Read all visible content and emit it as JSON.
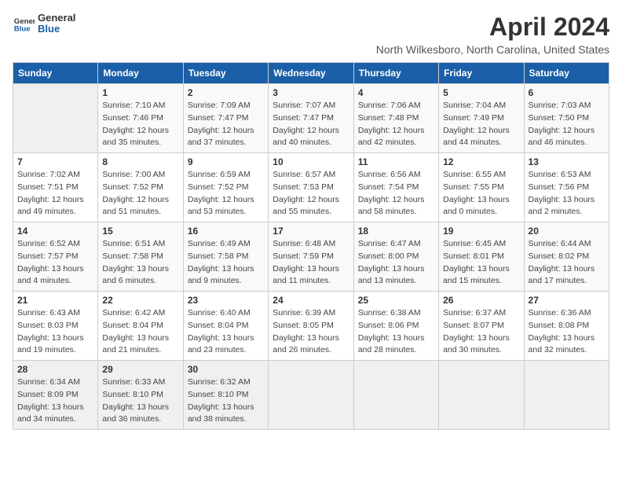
{
  "logo": {
    "general": "General",
    "blue": "Blue"
  },
  "title": "April 2024",
  "subtitle": "North Wilkesboro, North Carolina, United States",
  "weekdays": [
    "Sunday",
    "Monday",
    "Tuesday",
    "Wednesday",
    "Thursday",
    "Friday",
    "Saturday"
  ],
  "weeks": [
    [
      {
        "day": "",
        "info": ""
      },
      {
        "day": "1",
        "info": "Sunrise: 7:10 AM\nSunset: 7:46 PM\nDaylight: 12 hours\nand 35 minutes."
      },
      {
        "day": "2",
        "info": "Sunrise: 7:09 AM\nSunset: 7:47 PM\nDaylight: 12 hours\nand 37 minutes."
      },
      {
        "day": "3",
        "info": "Sunrise: 7:07 AM\nSunset: 7:47 PM\nDaylight: 12 hours\nand 40 minutes."
      },
      {
        "day": "4",
        "info": "Sunrise: 7:06 AM\nSunset: 7:48 PM\nDaylight: 12 hours\nand 42 minutes."
      },
      {
        "day": "5",
        "info": "Sunrise: 7:04 AM\nSunset: 7:49 PM\nDaylight: 12 hours\nand 44 minutes."
      },
      {
        "day": "6",
        "info": "Sunrise: 7:03 AM\nSunset: 7:50 PM\nDaylight: 12 hours\nand 46 minutes."
      }
    ],
    [
      {
        "day": "7",
        "info": "Sunrise: 7:02 AM\nSunset: 7:51 PM\nDaylight: 12 hours\nand 49 minutes."
      },
      {
        "day": "8",
        "info": "Sunrise: 7:00 AM\nSunset: 7:52 PM\nDaylight: 12 hours\nand 51 minutes."
      },
      {
        "day": "9",
        "info": "Sunrise: 6:59 AM\nSunset: 7:52 PM\nDaylight: 12 hours\nand 53 minutes."
      },
      {
        "day": "10",
        "info": "Sunrise: 6:57 AM\nSunset: 7:53 PM\nDaylight: 12 hours\nand 55 minutes."
      },
      {
        "day": "11",
        "info": "Sunrise: 6:56 AM\nSunset: 7:54 PM\nDaylight: 12 hours\nand 58 minutes."
      },
      {
        "day": "12",
        "info": "Sunrise: 6:55 AM\nSunset: 7:55 PM\nDaylight: 13 hours\nand 0 minutes."
      },
      {
        "day": "13",
        "info": "Sunrise: 6:53 AM\nSunset: 7:56 PM\nDaylight: 13 hours\nand 2 minutes."
      }
    ],
    [
      {
        "day": "14",
        "info": "Sunrise: 6:52 AM\nSunset: 7:57 PM\nDaylight: 13 hours\nand 4 minutes."
      },
      {
        "day": "15",
        "info": "Sunrise: 6:51 AM\nSunset: 7:58 PM\nDaylight: 13 hours\nand 6 minutes."
      },
      {
        "day": "16",
        "info": "Sunrise: 6:49 AM\nSunset: 7:58 PM\nDaylight: 13 hours\nand 9 minutes."
      },
      {
        "day": "17",
        "info": "Sunrise: 6:48 AM\nSunset: 7:59 PM\nDaylight: 13 hours\nand 11 minutes."
      },
      {
        "day": "18",
        "info": "Sunrise: 6:47 AM\nSunset: 8:00 PM\nDaylight: 13 hours\nand 13 minutes."
      },
      {
        "day": "19",
        "info": "Sunrise: 6:45 AM\nSunset: 8:01 PM\nDaylight: 13 hours\nand 15 minutes."
      },
      {
        "day": "20",
        "info": "Sunrise: 6:44 AM\nSunset: 8:02 PM\nDaylight: 13 hours\nand 17 minutes."
      }
    ],
    [
      {
        "day": "21",
        "info": "Sunrise: 6:43 AM\nSunset: 8:03 PM\nDaylight: 13 hours\nand 19 minutes."
      },
      {
        "day": "22",
        "info": "Sunrise: 6:42 AM\nSunset: 8:04 PM\nDaylight: 13 hours\nand 21 minutes."
      },
      {
        "day": "23",
        "info": "Sunrise: 6:40 AM\nSunset: 8:04 PM\nDaylight: 13 hours\nand 23 minutes."
      },
      {
        "day": "24",
        "info": "Sunrise: 6:39 AM\nSunset: 8:05 PM\nDaylight: 13 hours\nand 26 minutes."
      },
      {
        "day": "25",
        "info": "Sunrise: 6:38 AM\nSunset: 8:06 PM\nDaylight: 13 hours\nand 28 minutes."
      },
      {
        "day": "26",
        "info": "Sunrise: 6:37 AM\nSunset: 8:07 PM\nDaylight: 13 hours\nand 30 minutes."
      },
      {
        "day": "27",
        "info": "Sunrise: 6:36 AM\nSunset: 8:08 PM\nDaylight: 13 hours\nand 32 minutes."
      }
    ],
    [
      {
        "day": "28",
        "info": "Sunrise: 6:34 AM\nSunset: 8:09 PM\nDaylight: 13 hours\nand 34 minutes."
      },
      {
        "day": "29",
        "info": "Sunrise: 6:33 AM\nSunset: 8:10 PM\nDaylight: 13 hours\nand 36 minutes."
      },
      {
        "day": "30",
        "info": "Sunrise: 6:32 AM\nSunset: 8:10 PM\nDaylight: 13 hours\nand 38 minutes."
      },
      {
        "day": "",
        "info": ""
      },
      {
        "day": "",
        "info": ""
      },
      {
        "day": "",
        "info": ""
      },
      {
        "day": "",
        "info": ""
      }
    ]
  ]
}
